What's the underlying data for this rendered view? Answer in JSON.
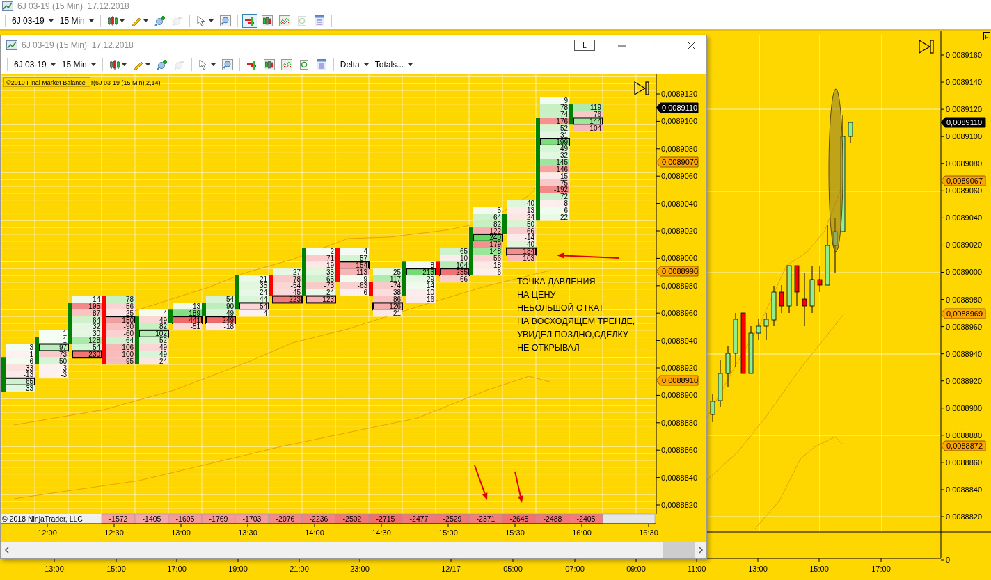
{
  "main_window": {
    "title": "6J 03-19 (15 Min)  17.12.2018",
    "toolbar": {
      "instrument": "6J 03-19",
      "interval": "15 Min",
      "groups": [
        [
          {
            "kind": "bars",
            "dropdown": true,
            "selected": false,
            "disabled": false
          },
          {
            "kind": "pencil",
            "dropdown": true,
            "selected": false,
            "disabled": false
          },
          {
            "kind": "zoom-in",
            "dropdown": false,
            "selected": false,
            "disabled": false
          },
          {
            "kind": "zoom-out",
            "dropdown": false,
            "selected": false,
            "disabled": true
          }
        ],
        [
          {
            "kind": "pointer",
            "dropdown": true,
            "selected": false,
            "disabled": false
          },
          {
            "kind": "search",
            "dropdown": false,
            "selected": false,
            "disabled": false
          }
        ],
        [
          {
            "kind": "chart-trader",
            "dropdown": false,
            "selected": true,
            "disabled": false
          },
          {
            "kind": "candles",
            "dropdown": false,
            "selected": false,
            "disabled": false
          },
          {
            "kind": "line-chart",
            "dropdown": false,
            "selected": false,
            "disabled": false
          },
          {
            "kind": "money",
            "dropdown": false,
            "selected": false,
            "disabled": true
          },
          {
            "kind": "form",
            "dropdown": false,
            "selected": false,
            "disabled": false
          }
        ]
      ]
    }
  },
  "main_chart": {
    "flag": "F",
    "price_labels": [
      "0,0089160",
      "0,0089140",
      "0,0089120",
      "0,0089100",
      "0,0089080",
      "0,0089060",
      "0,0089040",
      "0,0089020",
      "0,0089000",
      "0,0088980",
      "0,0088960",
      "0,0088940",
      "0,0088920",
      "0,0088900",
      "0,0088880",
      "0,0088860",
      "0,0088840",
      "0,0088820"
    ],
    "price_markers": [
      {
        "text": "0,0089110",
        "color": "#000000"
      },
      {
        "text": "0,0089067",
        "color": "#ffa500"
      },
      {
        "text": "0,0088969",
        "color": "#ffa500"
      },
      {
        "text": "0,0088872",
        "color": "#ffa500"
      }
    ],
    "lower_panel_label": "0",
    "time_labels": [
      "13:00",
      "15:00",
      "17:00",
      "19:00",
      "21:00",
      "23:00",
      "12/17",
      "05:00",
      "07:00",
      "09:00",
      "11:00",
      "13:00",
      "15:00",
      "17:00"
    ]
  },
  "chart_window": {
    "title": "6J 03-19 (15 Min)  17.12.2018",
    "link_button": "L",
    "toolbar": {
      "instrument": "6J 03-19",
      "interval": "15 Min",
      "groups": [
        [
          {
            "kind": "bars",
            "dropdown": true,
            "selected": false,
            "disabled": false
          },
          {
            "kind": "pencil",
            "dropdown": true,
            "selected": false,
            "disabled": false
          },
          {
            "kind": "zoom-in",
            "dropdown": false,
            "selected": false,
            "disabled": false
          },
          {
            "kind": "zoom-out",
            "dropdown": false,
            "selected": false,
            "disabled": true
          }
        ],
        [
          {
            "kind": "pointer",
            "dropdown": true,
            "selected": false,
            "disabled": false
          },
          {
            "kind": "search",
            "dropdown": false,
            "selected": false,
            "disabled": false
          }
        ],
        [
          {
            "kind": "chart-trader",
            "dropdown": false,
            "selected": false,
            "disabled": false
          },
          {
            "kind": "candles",
            "dropdown": false,
            "selected": false,
            "disabled": false
          },
          {
            "kind": "line-chart",
            "dropdown": false,
            "selected": false,
            "disabled": false
          },
          {
            "kind": "money",
            "dropdown": false,
            "selected": false,
            "disabled": false
          },
          {
            "kind": "form",
            "dropdown": false,
            "selected": false,
            "disabled": false
          }
        ]
      ],
      "menus": [
        {
          "label": "Delta"
        },
        {
          "label": "Totals..."
        }
      ]
    },
    "indicator_label": "©2010 Final Market Balance",
    "indicator_params": "r(6J 03-19 (15 Min),2,14)",
    "footprint": {
      "columns": [
        {
          "bullish": true,
          "cells": [
            {
              "value": "3",
              "boxed": false
            },
            {
              "value": "-1",
              "boxed": false
            },
            {
              "value": "6",
              "boxed": false
            },
            {
              "value": "-33",
              "boxed": false
            },
            {
              "value": "-13",
              "boxed": false
            },
            {
              "value": "65",
              "boxed": true
            },
            {
              "value": "33",
              "boxed": false
            }
          ]
        },
        {
          "bullish": true,
          "cells": [
            {
              "value": "1",
              "boxed": false
            },
            {
              "value": "1",
              "boxed": false
            },
            {
              "value": "97",
              "boxed": true
            },
            {
              "value": "-73",
              "boxed": false
            },
            {
              "value": "50",
              "boxed": false
            },
            {
              "value": "-3",
              "boxed": false
            },
            {
              "value": "-3",
              "boxed": false
            }
          ]
        },
        {
          "bullish": true,
          "cells": [
            {
              "value": "14",
              "boxed": false
            },
            {
              "value": "-195",
              "boxed": false
            },
            {
              "value": "-87",
              "boxed": false
            },
            {
              "value": "64",
              "boxed": false
            },
            {
              "value": "32",
              "boxed": false
            },
            {
              "value": "30",
              "boxed": false
            },
            {
              "value": "128",
              "boxed": false
            },
            {
              "value": "54",
              "boxed": false
            },
            {
              "value": "-230",
              "boxed": true
            }
          ]
        },
        {
          "bullish": false,
          "cells": [
            {
              "value": "78",
              "boxed": false
            },
            {
              "value": "-56",
              "boxed": false
            },
            {
              "value": "-25",
              "boxed": false
            },
            {
              "value": "-150",
              "boxed": true
            },
            {
              "value": "-90",
              "boxed": false
            },
            {
              "value": "-60",
              "boxed": false
            },
            {
              "value": "64",
              "boxed": false
            },
            {
              "value": "-106",
              "boxed": false
            },
            {
              "value": "-100",
              "boxed": false
            },
            {
              "value": "-95",
              "boxed": false
            }
          ]
        },
        {
          "bullish": true,
          "cells": [
            {
              "value": "4",
              "boxed": false
            },
            {
              "value": "-49",
              "boxed": false
            },
            {
              "value": "82",
              "boxed": false
            },
            {
              "value": "102",
              "boxed": true
            },
            {
              "value": "52",
              "boxed": false
            },
            {
              "value": "-49",
              "boxed": false
            },
            {
              "value": "49",
              "boxed": false
            },
            {
              "value": "-24",
              "boxed": false
            }
          ]
        },
        {
          "bullish": true,
          "cells": [
            {
              "value": "13",
              "boxed": false
            },
            {
              "value": "189",
              "boxed": false
            },
            {
              "value": "-441",
              "boxed": true
            },
            {
              "value": "-51",
              "boxed": false
            }
          ]
        },
        {
          "bullish": true,
          "cells": [
            {
              "value": "54",
              "boxed": false
            },
            {
              "value": "90",
              "boxed": false
            },
            {
              "value": "49",
              "boxed": false
            },
            {
              "value": "-249",
              "boxed": true
            },
            {
              "value": "-18",
              "boxed": false
            }
          ]
        },
        {
          "bullish": true,
          "cells": [
            {
              "value": "21",
              "boxed": false
            },
            {
              "value": "35",
              "boxed": false
            },
            {
              "value": "24",
              "boxed": false
            },
            {
              "value": "44",
              "boxed": false
            },
            {
              "value": "-54",
              "boxed": true
            },
            {
              "value": "-4",
              "boxed": false
            }
          ]
        },
        {
          "bullish": false,
          "cells": [
            {
              "value": "27",
              "boxed": false
            },
            {
              "value": "-78",
              "boxed": false
            },
            {
              "value": "-54",
              "boxed": false
            },
            {
              "value": "-45",
              "boxed": false
            },
            {
              "value": "-223",
              "boxed": true
            }
          ]
        },
        {
          "bullish": true,
          "cells": [
            {
              "value": "2",
              "boxed": false
            },
            {
              "value": "-71",
              "boxed": false
            },
            {
              "value": "-19",
              "boxed": false
            },
            {
              "value": "35",
              "boxed": false
            },
            {
              "value": "65",
              "boxed": false
            },
            {
              "value": "-73",
              "boxed": false
            },
            {
              "value": "24",
              "boxed": false
            },
            {
              "value": "-123",
              "boxed": true
            }
          ]
        },
        {
          "bullish": false,
          "cells": [
            {
              "value": "4",
              "boxed": false
            },
            {
              "value": "57",
              "boxed": false
            },
            {
              "value": "-154",
              "boxed": true
            },
            {
              "value": "-113",
              "boxed": false
            },
            {
              "value": "9",
              "boxed": false
            },
            {
              "value": "-63",
              "boxed": false
            },
            {
              "value": "-6",
              "boxed": false
            }
          ]
        },
        {
          "bullish": false,
          "cells": [
            {
              "value": "25",
              "boxed": false
            },
            {
              "value": "117",
              "boxed": false
            },
            {
              "value": "-74",
              "boxed": false
            },
            {
              "value": "-38",
              "boxed": false
            },
            {
              "value": "-86",
              "boxed": false
            },
            {
              "value": "-126",
              "boxed": true
            },
            {
              "value": "-21",
              "boxed": false
            }
          ]
        },
        {
          "bullish": true,
          "cells": [
            {
              "value": "8",
              "boxed": false
            },
            {
              "value": "213",
              "boxed": true
            },
            {
              "value": "29",
              "boxed": false
            },
            {
              "value": "14",
              "boxed": false
            },
            {
              "value": "-10",
              "boxed": false
            },
            {
              "value": "-16",
              "boxed": false
            }
          ]
        },
        {
          "bullish": false,
          "cells": [
            {
              "value": "65",
              "boxed": false
            },
            {
              "value": "-10",
              "boxed": false
            },
            {
              "value": "104",
              "boxed": false
            },
            {
              "value": "-235",
              "boxed": true
            },
            {
              "value": "-66",
              "boxed": false
            }
          ]
        },
        {
          "bullish": true,
          "cells": [
            {
              "value": "5",
              "boxed": false
            },
            {
              "value": "64",
              "boxed": false
            },
            {
              "value": "82",
              "boxed": false
            },
            {
              "value": "-122",
              "boxed": false
            },
            {
              "value": "240",
              "boxed": true
            },
            {
              "value": "-179",
              "boxed": false
            },
            {
              "value": "148",
              "boxed": false
            },
            {
              "value": "-56",
              "boxed": false
            },
            {
              "value": "-18",
              "boxed": false
            },
            {
              "value": "-6",
              "boxed": false
            }
          ]
        },
        {
          "bullish": true,
          "cells": [
            {
              "value": "40",
              "boxed": false
            },
            {
              "value": "-13",
              "boxed": false
            },
            {
              "value": "-24",
              "boxed": false
            },
            {
              "value": "50",
              "boxed": false
            },
            {
              "value": "-66",
              "boxed": false
            },
            {
              "value": "-14",
              "boxed": false
            },
            {
              "value": "40",
              "boxed": false
            },
            {
              "value": "-184",
              "boxed": true
            },
            {
              "value": "-103",
              "boxed": false
            }
          ]
        },
        {
          "bullish": true,
          "cells": [
            {
              "value": "9",
              "boxed": false
            },
            {
              "value": "78",
              "boxed": false
            },
            {
              "value": "74",
              "boxed": false
            },
            {
              "value": "-176",
              "boxed": false
            },
            {
              "value": "52",
              "boxed": false
            },
            {
              "value": "31",
              "boxed": false
            },
            {
              "value": "199",
              "boxed": true
            },
            {
              "value": "49",
              "boxed": false
            },
            {
              "value": "32",
              "boxed": false
            },
            {
              "value": "145",
              "boxed": false
            },
            {
              "value": "-146",
              "boxed": false
            },
            {
              "value": "-15",
              "boxed": false
            },
            {
              "value": "-75",
              "boxed": false
            },
            {
              "value": "-192",
              "boxed": false
            },
            {
              "value": "72",
              "boxed": false
            },
            {
              "value": "-8",
              "boxed": false
            },
            {
              "value": "6",
              "boxed": false
            },
            {
              "value": "22",
              "boxed": false
            }
          ]
        },
        {
          "bullish": true,
          "cells": [
            {
              "value": "119",
              "boxed": false
            },
            {
              "value": "-76",
              "boxed": false
            },
            {
              "value": "144",
              "boxed": true
            },
            {
              "value": "-104",
              "boxed": false
            }
          ]
        }
      ]
    },
    "copyright": "© 2018 NinjaTrader, LLC",
    "totals": [
      "-1572",
      "-1405",
      "-1695",
      "-1769",
      "-1703",
      "-2076",
      "-2236",
      "-2502",
      "-2715",
      "-2477",
      "-2529",
      "-2371",
      "-2645",
      "-2488",
      "-2405"
    ],
    "annotation": [
      "ТОЧКА ДАВЛЕНИЯ",
      "НА ЦЕНУ",
      "НЕБОЛЬШОЙ ОТКАТ",
      "НА ВОСХОДЯЩЕМ ТРЕНДЕ,",
      "УВИДЕЛ ПОЗДНО,СДЕЛКУ",
      "НЕ ОТКРЫВАЛ"
    ],
    "price_labels": [
      "0,0089120",
      "0,0089100",
      "0,0089080",
      "0,0089060",
      "0,0089040",
      "0,0089020",
      "0,0089000",
      "0,0088980",
      "0,0088960",
      "0,0088940",
      "0,0088920",
      "0,0088900",
      "0,0088880",
      "0,0088860",
      "0,0088840",
      "0,0088820"
    ],
    "price_markers": [
      {
        "text": "0,0089110",
        "color": "#000000"
      },
      {
        "text": "0,0089070",
        "color": "#ffa500"
      },
      {
        "text": "0,0088990",
        "color": "#ffa500"
      },
      {
        "text": "0,0088910",
        "color": "#ffa500"
      }
    ],
    "time_labels": [
      "12:00",
      "12:30",
      "13:00",
      "13:30",
      "14:00",
      "14:30",
      "15:00",
      "15:30",
      "16:00",
      "16:30"
    ]
  }
}
